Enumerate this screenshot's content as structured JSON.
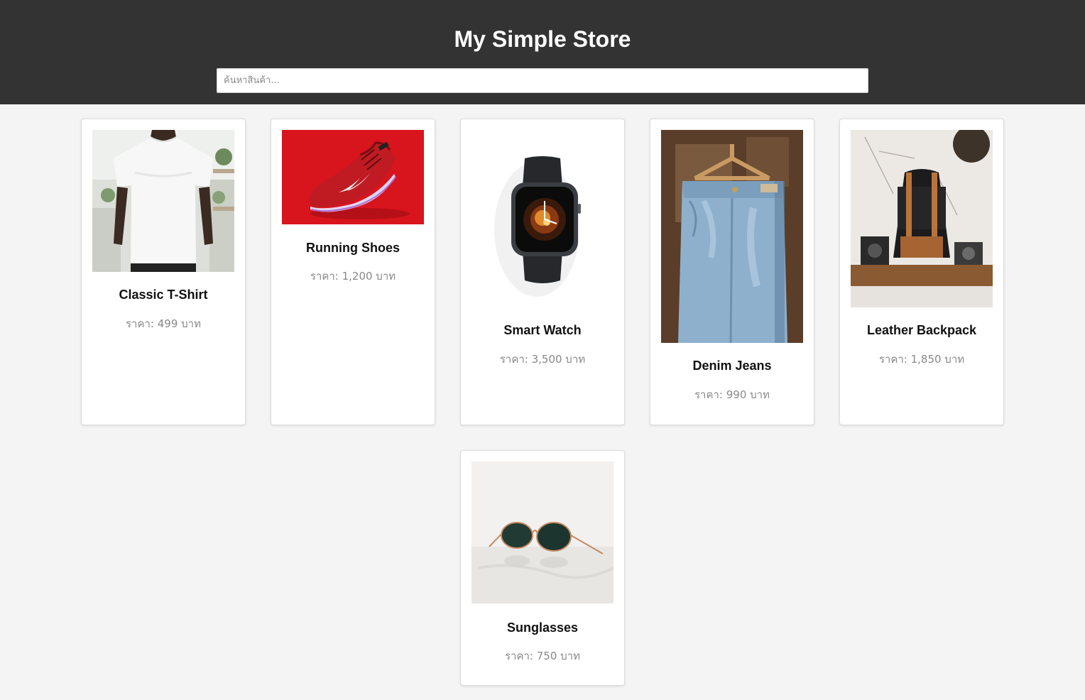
{
  "header": {
    "title": "My Simple Store",
    "search_placeholder": "ค้นหาสินค้า..."
  },
  "colors": {
    "header_bg": "#333333",
    "page_bg": "#f4f4f4",
    "card_bg": "#ffffff",
    "price_text": "#888888"
  },
  "products": [
    {
      "name": "Classic T-Shirt",
      "price": "ราคา: 499 บาท",
      "image": "tshirt-photo"
    },
    {
      "name": "Running Shoes",
      "price": "ราคา: 1,200 บาท",
      "image": "running-shoe-photo"
    },
    {
      "name": "Smart Watch",
      "price": "ราคา: 3,500 บาท",
      "image": "smart-watch-photo"
    },
    {
      "name": "Denim Jeans",
      "price": "ราคา: 990 บาท",
      "image": "denim-jeans-photo"
    },
    {
      "name": "Leather Backpack",
      "price": "ราคา: 1,850 บาท",
      "image": "backpack-photo"
    },
    {
      "name": "Sunglasses",
      "price": "ราคา: 750 บาท",
      "image": "sunglasses-photo"
    }
  ]
}
